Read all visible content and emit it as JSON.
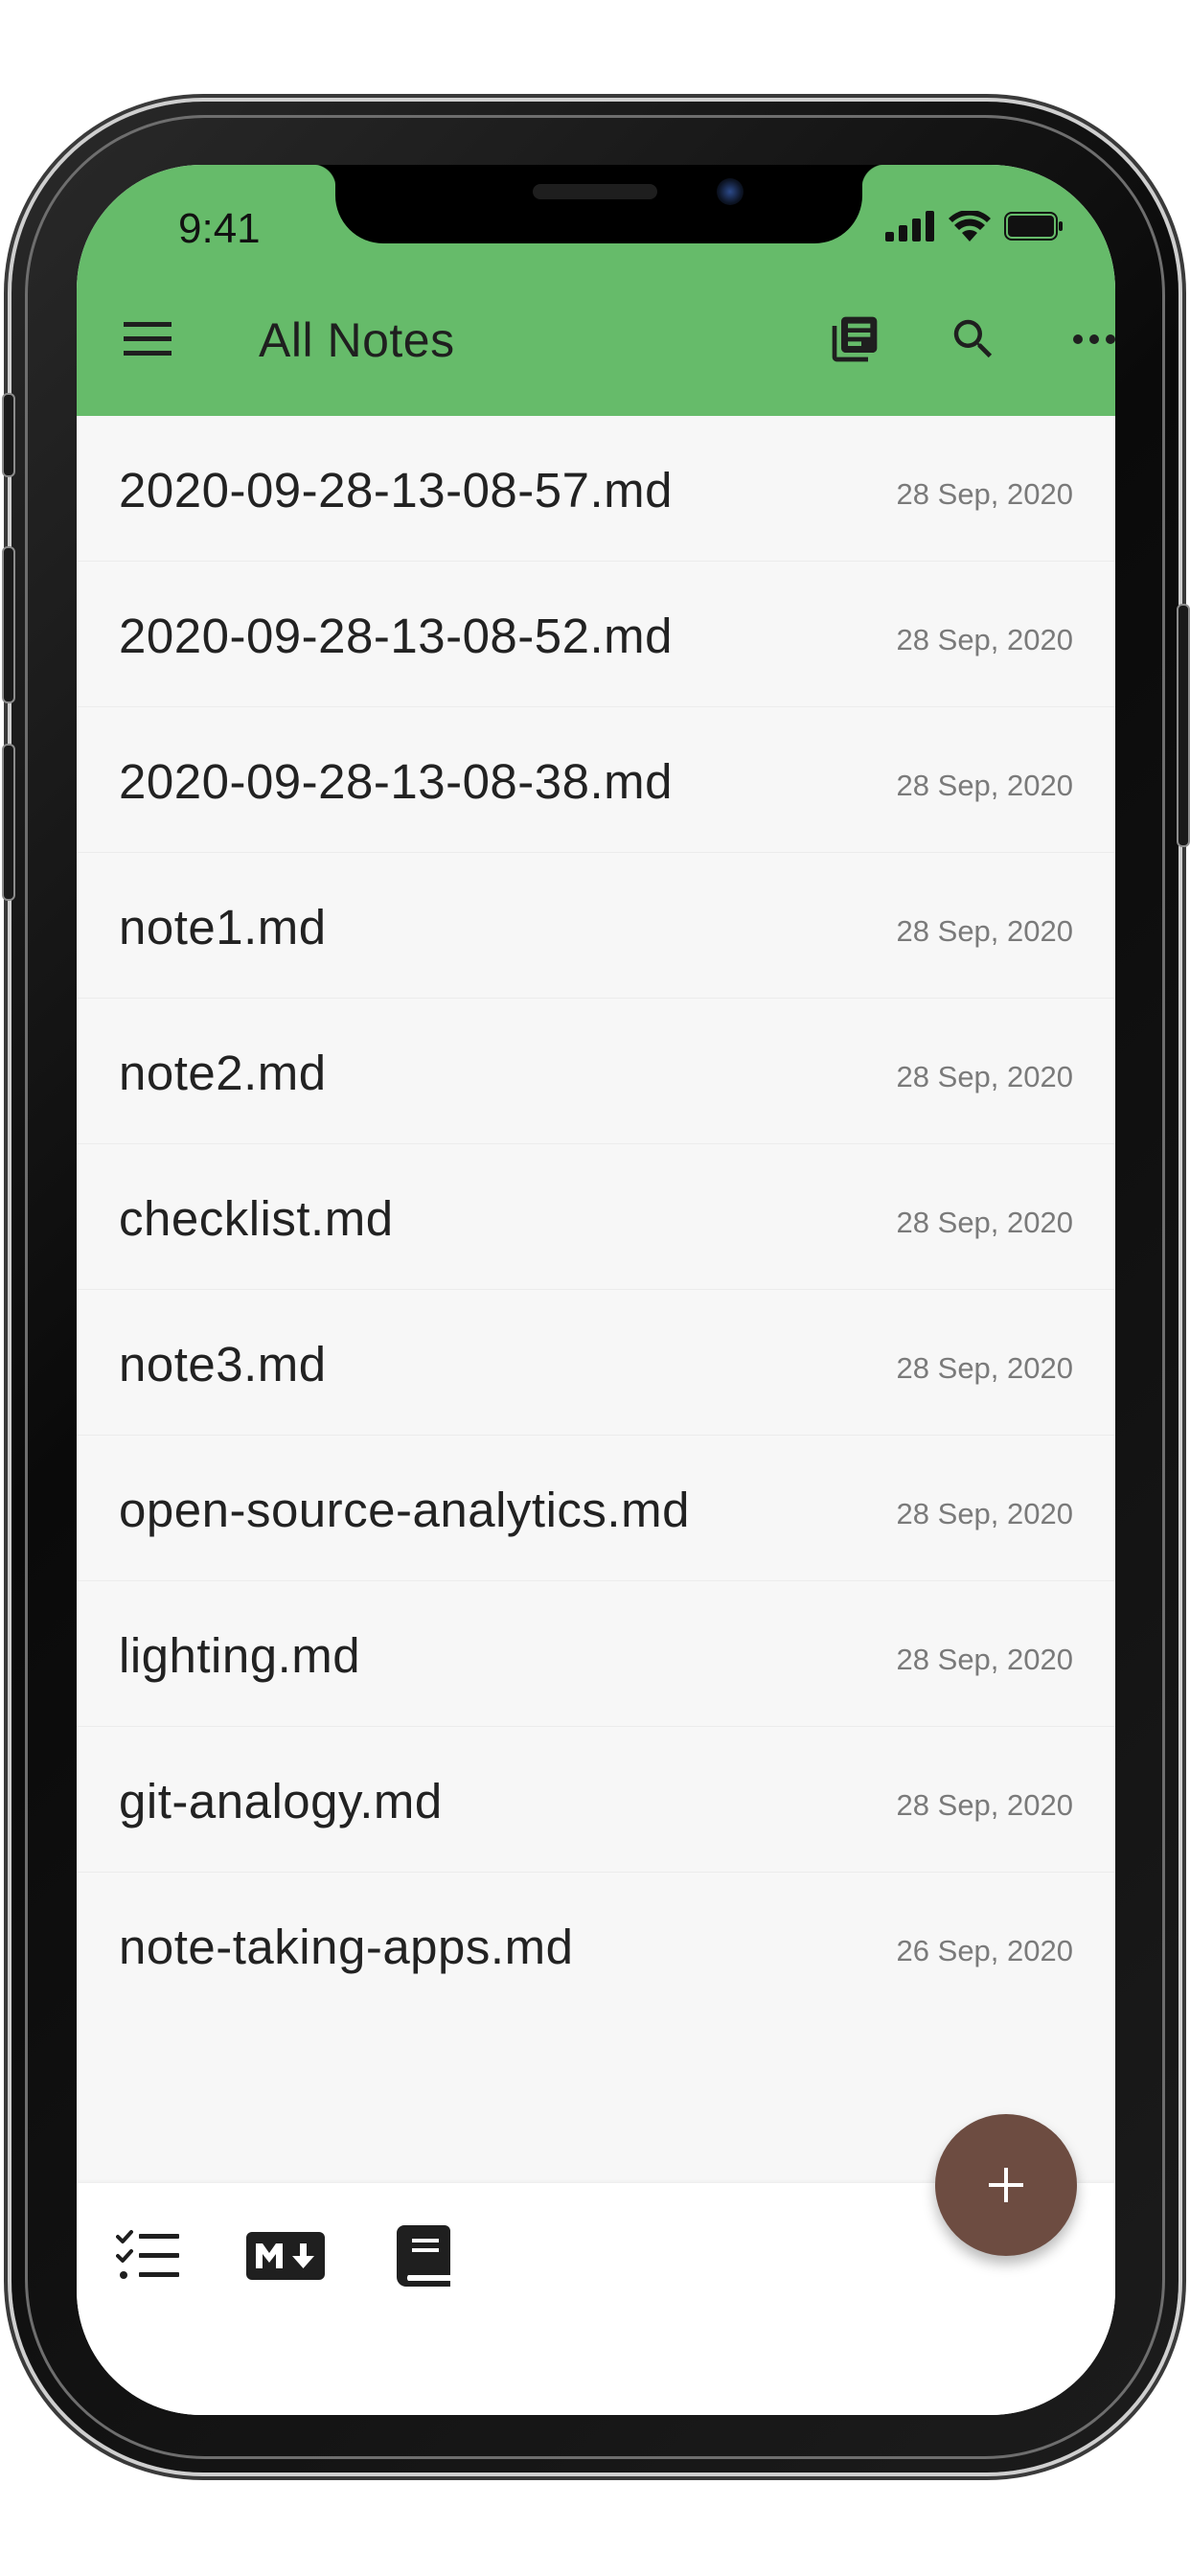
{
  "status_bar": {
    "time": "9:41"
  },
  "app_bar": {
    "title": "All Notes",
    "background_color": "#66bb6a",
    "actions": [
      {
        "icon": "library-books-icon"
      },
      {
        "icon": "search-icon"
      },
      {
        "icon": "more-horiz-icon"
      }
    ],
    "leading_icon": "menu-icon"
  },
  "notes": [
    {
      "title": "2020-09-28-13-08-57.md",
      "date": "28 Sep, 2020"
    },
    {
      "title": "2020-09-28-13-08-52.md",
      "date": "28 Sep, 2020"
    },
    {
      "title": "2020-09-28-13-08-38.md",
      "date": "28 Sep, 2020"
    },
    {
      "title": "note1.md",
      "date": "28 Sep, 2020"
    },
    {
      "title": "note2.md",
      "date": "28 Sep, 2020"
    },
    {
      "title": "checklist.md",
      "date": "28 Sep, 2020"
    },
    {
      "title": "note3.md",
      "date": "28 Sep, 2020"
    },
    {
      "title": "open-source-analytics.md",
      "date": "28 Sep, 2020"
    },
    {
      "title": "lighting.md",
      "date": "28 Sep, 2020"
    },
    {
      "title": "git-analogy.md",
      "date": "28 Sep, 2020"
    },
    {
      "title": "note-taking-apps.md",
      "date": "26 Sep, 2020"
    }
  ],
  "bottom_bar": {
    "icons": [
      "checklist-icon",
      "markdown-icon",
      "journal-icon"
    ]
  },
  "fab": {
    "label": "+",
    "color": "#6d4c41"
  }
}
